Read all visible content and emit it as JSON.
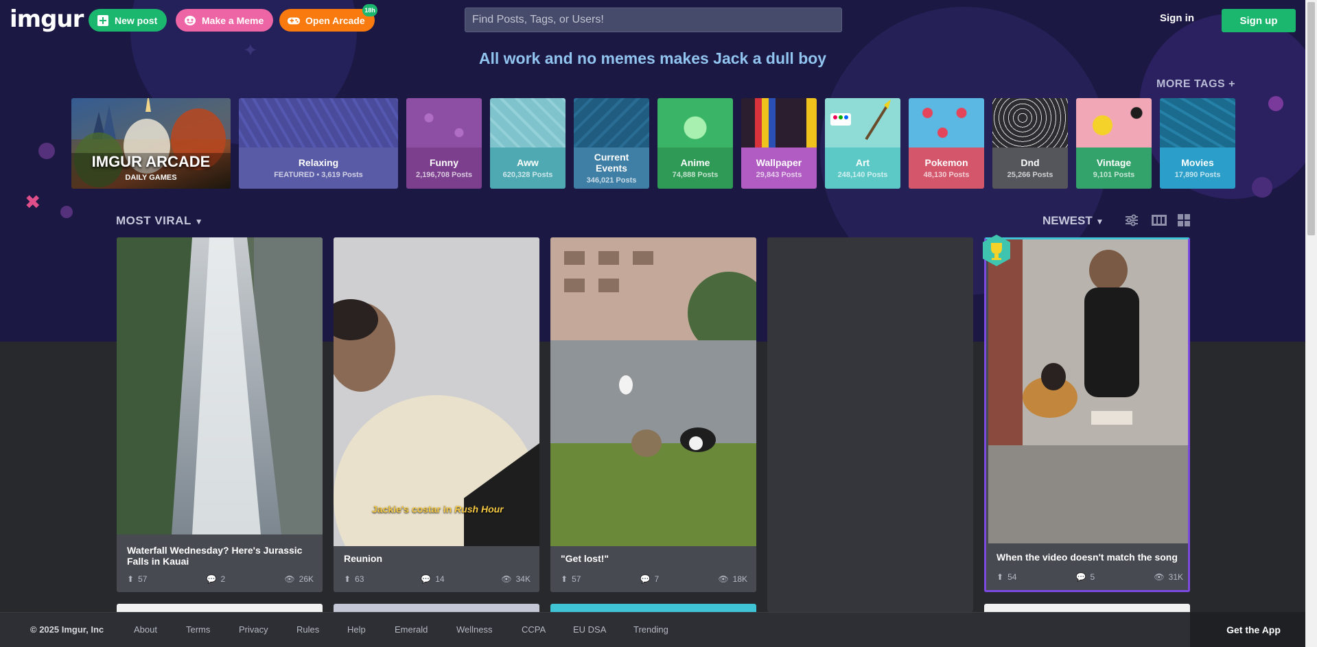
{
  "header": {
    "logo": "imgur",
    "new_post": "New post",
    "make_meme": "Make a Meme",
    "open_arcade": "Open Arcade",
    "arcade_badge": "18h",
    "search_placeholder": "Find Posts, Tags, or Users!",
    "sign_in": "Sign in",
    "sign_up": "Sign up"
  },
  "tagline": "All work and no memes makes Jack a dull boy",
  "more_tags": "MORE TAGS +",
  "arcade": {
    "title": "IMGUR ARCADE",
    "subtitle": "DAILY GAMES"
  },
  "tags": [
    {
      "name": "Relaxing",
      "count": "FEATURED • 3,619 Posts",
      "color": "#5a5ba6",
      "pattern": "#4a4c9b"
    },
    {
      "name": "Funny",
      "count": "2,196,708 Posts",
      "color": "#7b3f8d",
      "pattern": "#8d4fa3"
    },
    {
      "name": "Aww",
      "count": "620,328 Posts",
      "color": "#4ea9b3",
      "pattern": "#7fc3cc"
    },
    {
      "name": "Current Events",
      "count": "346,021 Posts",
      "color": "#3f7fa6",
      "pattern": "#1f5c80"
    },
    {
      "name": "Anime",
      "count": "74,888 Posts",
      "color": "#2e9a55",
      "pattern": "#3ab567"
    },
    {
      "name": "Wallpaper",
      "count": "29,843 Posts",
      "color": "#b05cc2",
      "pattern": "#2b1e2e"
    },
    {
      "name": "Art",
      "count": "248,140 Posts",
      "color": "#5cc9c6",
      "pattern": "#8fdcd6"
    },
    {
      "name": "Pokemon",
      "count": "48,130 Posts",
      "color": "#d3566b",
      "pattern": "#5ab8e3"
    },
    {
      "name": "Dnd",
      "count": "25,266 Posts",
      "color": "#55565c",
      "pattern": "#2d2d31"
    },
    {
      "name": "Vintage",
      "count": "9,101 Posts",
      "color": "#34a36b",
      "pattern": "#f2a7b6"
    },
    {
      "name": "Movies",
      "count": "17,890 Posts",
      "color": "#2b9fc9",
      "pattern": "#1b6b8f"
    }
  ],
  "sort": {
    "left": "MOST VIRAL",
    "right": "NEWEST"
  },
  "posts": [
    {
      "title": "Waterfall Wednesday? Here's Jurassic Falls in Kauai",
      "ups": "57",
      "comments": "2",
      "views": "26K"
    },
    {
      "title": "Reunion",
      "caption_plain": "Jackie's costar in ",
      "caption_italic": "Rush Hour",
      "ups": "63",
      "comments": "14",
      "views": "34K"
    },
    {
      "title": "\"Get lost!\"",
      "ups": "57",
      "comments": "7",
      "views": "18K"
    },
    {
      "title": "When the video doesn't match the song",
      "ups": "54",
      "comments": "5",
      "views": "31K"
    }
  ],
  "footer": {
    "copyright": "© 2025 Imgur, Inc",
    "links": [
      "About",
      "Terms",
      "Privacy",
      "Rules",
      "Help",
      "Emerald",
      "Wellness",
      "CCPA",
      "EU DSA",
      "Trending"
    ],
    "get_app": "Get the App"
  },
  "colors": {
    "hero": "#1b1843",
    "new_post": "#1bb76e",
    "make_meme": "#ed65a5",
    "open_arcade": "#f97a0e",
    "promoted_border": "#7b48e0"
  }
}
